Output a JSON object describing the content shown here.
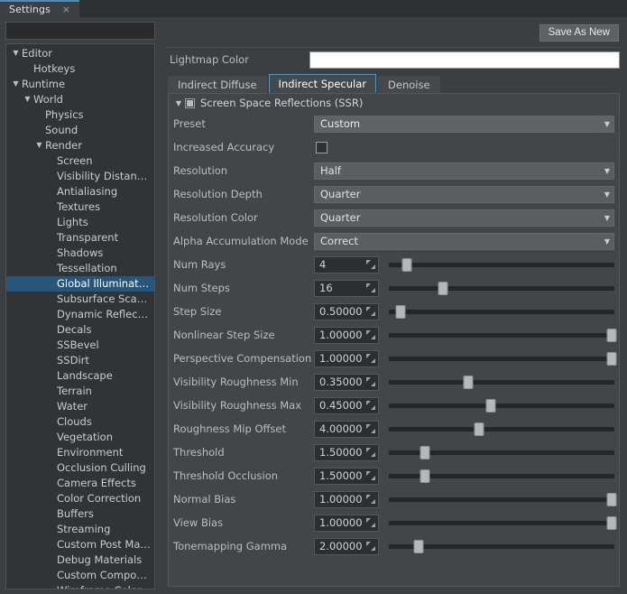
{
  "window": {
    "tab_label": "Settings",
    "close_icon": "×"
  },
  "sidebar": {
    "filter_value": "",
    "filter_placeholder": "",
    "items": [
      {
        "label": "Editor",
        "depth": 0,
        "arrow": "▼",
        "selected": false
      },
      {
        "label": "Hotkeys",
        "depth": 1,
        "arrow": "",
        "selected": false
      },
      {
        "label": "Runtime",
        "depth": 0,
        "arrow": "▼",
        "selected": false
      },
      {
        "label": "World",
        "depth": 1,
        "arrow": "▼",
        "selected": false
      },
      {
        "label": "Physics",
        "depth": 2,
        "arrow": "",
        "selected": false
      },
      {
        "label": "Sound",
        "depth": 2,
        "arrow": "",
        "selected": false
      },
      {
        "label": "Render",
        "depth": 2,
        "arrow": "▼",
        "selected": false
      },
      {
        "label": "Screen",
        "depth": 3,
        "arrow": "",
        "selected": false
      },
      {
        "label": "Visibility Distances",
        "depth": 3,
        "arrow": "",
        "selected": false
      },
      {
        "label": "Antialiasing",
        "depth": 3,
        "arrow": "",
        "selected": false
      },
      {
        "label": "Textures",
        "depth": 3,
        "arrow": "",
        "selected": false
      },
      {
        "label": "Lights",
        "depth": 3,
        "arrow": "",
        "selected": false
      },
      {
        "label": "Transparent",
        "depth": 3,
        "arrow": "",
        "selected": false
      },
      {
        "label": "Shadows",
        "depth": 3,
        "arrow": "",
        "selected": false
      },
      {
        "label": "Tessellation",
        "depth": 3,
        "arrow": "",
        "selected": false
      },
      {
        "label": "Global Illumination",
        "depth": 3,
        "arrow": "",
        "selected": true
      },
      {
        "label": "Subsurface Scattering",
        "depth": 3,
        "arrow": "",
        "selected": false
      },
      {
        "label": "Dynamic Reflections",
        "depth": 3,
        "arrow": "",
        "selected": false
      },
      {
        "label": "Decals",
        "depth": 3,
        "arrow": "",
        "selected": false
      },
      {
        "label": "SSBevel",
        "depth": 3,
        "arrow": "",
        "selected": false
      },
      {
        "label": "SSDirt",
        "depth": 3,
        "arrow": "",
        "selected": false
      },
      {
        "label": "Landscape",
        "depth": 3,
        "arrow": "",
        "selected": false
      },
      {
        "label": "Terrain",
        "depth": 3,
        "arrow": "",
        "selected": false
      },
      {
        "label": "Water",
        "depth": 3,
        "arrow": "",
        "selected": false
      },
      {
        "label": "Clouds",
        "depth": 3,
        "arrow": "",
        "selected": false
      },
      {
        "label": "Vegetation",
        "depth": 3,
        "arrow": "",
        "selected": false
      },
      {
        "label": "Environment",
        "depth": 3,
        "arrow": "",
        "selected": false
      },
      {
        "label": "Occlusion Culling",
        "depth": 3,
        "arrow": "",
        "selected": false
      },
      {
        "label": "Camera Effects",
        "depth": 3,
        "arrow": "",
        "selected": false
      },
      {
        "label": "Color Correction",
        "depth": 3,
        "arrow": "",
        "selected": false
      },
      {
        "label": "Buffers",
        "depth": 3,
        "arrow": "",
        "selected": false
      },
      {
        "label": "Streaming",
        "depth": 3,
        "arrow": "",
        "selected": false
      },
      {
        "label": "Custom Post Materials",
        "depth": 3,
        "arrow": "",
        "selected": false
      },
      {
        "label": "Debug Materials",
        "depth": 3,
        "arrow": "",
        "selected": false
      },
      {
        "label": "Custom Composite ...",
        "depth": 3,
        "arrow": "",
        "selected": false
      },
      {
        "label": "Wireframe Color",
        "depth": 3,
        "arrow": "",
        "selected": false
      }
    ]
  },
  "toolbar": {
    "save_as_new_label": "Save As New"
  },
  "lightmap": {
    "label": "Lightmap Color",
    "swatch_color": "#ffffff"
  },
  "tabs": {
    "items": [
      {
        "label": "Indirect Diffuse",
        "active": false
      },
      {
        "label": "Indirect Specular",
        "active": true
      },
      {
        "label": "Denoise",
        "active": false
      }
    ]
  },
  "group": {
    "title": "Screen Space Reflections (SSR)",
    "collapse_arrow": "▼",
    "checkbox_state": "partial"
  },
  "properties": [
    {
      "label": "Preset",
      "kind": "select",
      "value": "Custom",
      "bright": true
    },
    {
      "label": "Increased Accuracy",
      "kind": "checkbox",
      "value": "",
      "checked": false
    },
    {
      "label": "Resolution",
      "kind": "select",
      "value": "Half",
      "bright": false
    },
    {
      "label": "Resolution Depth",
      "kind": "select",
      "value": "Quarter",
      "bright": false
    },
    {
      "label": "Resolution Color",
      "kind": "select",
      "value": "Quarter",
      "bright": false
    },
    {
      "label": "Alpha Accumulation Mode",
      "kind": "select",
      "value": "Correct",
      "bright": false
    },
    {
      "label": "Num Rays",
      "kind": "slider",
      "value": "4",
      "pct": 8
    },
    {
      "label": "Num Steps",
      "kind": "slider",
      "value": "16",
      "pct": 24
    },
    {
      "label": "Step Size",
      "kind": "slider",
      "value": "0.50000",
      "pct": 5
    },
    {
      "label": "Nonlinear Step Size",
      "kind": "slider",
      "value": "1.00000",
      "pct": 99
    },
    {
      "label": "Perspective Compensation",
      "kind": "slider",
      "value": "1.00000",
      "pct": 99
    },
    {
      "label": "Visibility Roughness Min",
      "kind": "slider",
      "value": "0.35000",
      "pct": 35
    },
    {
      "label": "Visibility Roughness Max",
      "kind": "slider",
      "value": "0.45000",
      "pct": 45
    },
    {
      "label": "Roughness Mip Offset",
      "kind": "slider",
      "value": "4.00000",
      "pct": 40
    },
    {
      "label": "Threshold",
      "kind": "slider",
      "value": "1.50000",
      "pct": 16
    },
    {
      "label": "Threshold Occlusion",
      "kind": "slider",
      "value": "1.50000",
      "pct": 16
    },
    {
      "label": "Normal Bias",
      "kind": "slider",
      "value": "1.00000",
      "pct": 99
    },
    {
      "label": "View Bias",
      "kind": "slider",
      "value": "1.00000",
      "pct": 99
    },
    {
      "label": "Tonemapping Gamma",
      "kind": "slider",
      "value": "2.00000",
      "pct": 13
    }
  ],
  "colors": {
    "accent": "#4a8fb8",
    "selection": "#28557a",
    "panel_bg": "#3c3f41",
    "group_bg": "#434648"
  }
}
